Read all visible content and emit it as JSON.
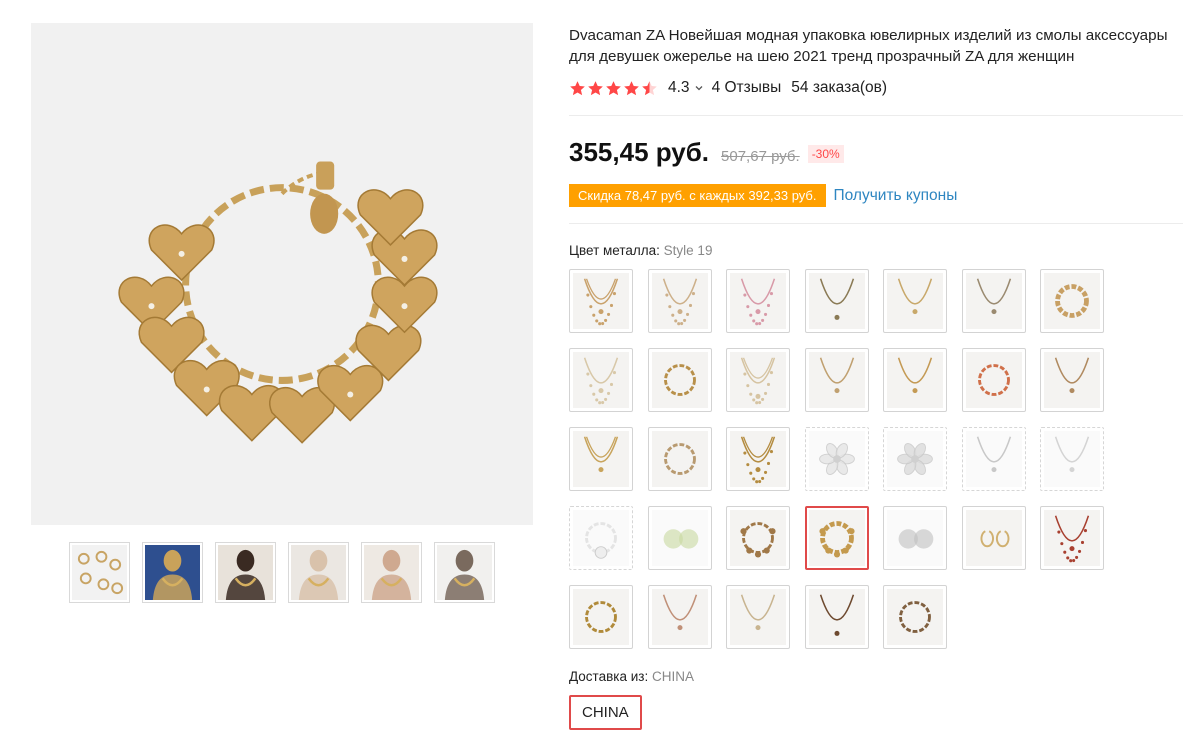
{
  "product": {
    "title": "Dvacaman ZA Новейшая модная упаковка ювелирных изделий из смолы аксессуары для девушек ожерелье на шею 2021 тренд прозрачный ZA для женщин",
    "rating": "4.3",
    "rating_stars": 4.5,
    "reviews": "4 Отзывы",
    "orders": "54 заказа(ов)"
  },
  "price": {
    "current": "355,45 руб.",
    "old": "507,67 руб.",
    "discount": "-30%"
  },
  "coupon": {
    "text": "Скидка 78,47 руб. с каждых 392,33 руб.",
    "link": "Получить купоны"
  },
  "sku": {
    "label": "Цвет металла:",
    "selected_value": "Style 19",
    "options": [
      {
        "kind": "necklace-layered",
        "color": "#c9a26c"
      },
      {
        "kind": "necklace-beads",
        "color": "#cdb08a"
      },
      {
        "kind": "necklace-pink",
        "color": "#d89aa8"
      },
      {
        "kind": "necklace-long",
        "color": "#8a7a55"
      },
      {
        "kind": "necklace-pendant",
        "color": "#c8a86a"
      },
      {
        "kind": "necklace-thin",
        "color": "#9a8a70"
      },
      {
        "kind": "bracelet-chunky",
        "color": "#c8a064"
      },
      {
        "kind": "necklace-pearl",
        "color": "#d8c8a8"
      },
      {
        "kind": "bracelet-gold",
        "color": "#b8904a"
      },
      {
        "kind": "necklace-pearl-long",
        "color": "#d6c4a2"
      },
      {
        "kind": "necklace-choker",
        "color": "#c0a070"
      },
      {
        "kind": "necklace-gold-drop",
        "color": "#c49a54"
      },
      {
        "kind": "bracelet-colorful",
        "color": "#d0704a"
      },
      {
        "kind": "necklace-charm",
        "color": "#b08a60"
      },
      {
        "kind": "necklace-chain-double",
        "color": "#c8a45c"
      },
      {
        "kind": "bracelet-beads",
        "color": "#b89a70"
      },
      {
        "kind": "necklace-chain-layered",
        "color": "#b48c40"
      },
      {
        "kind": "resin-flower",
        "color": "#e6e6e6"
      },
      {
        "kind": "resin-flower-2",
        "color": "#dcdcdc"
      },
      {
        "kind": "necklace-flower-white",
        "color": "#c8c8c8"
      },
      {
        "kind": "necklace-flower-clear",
        "color": "#d4d4d4"
      },
      {
        "kind": "bracelet-flower",
        "color": "#e4e4e4"
      },
      {
        "kind": "earrings-resin-green",
        "color": "#c8d8a0"
      },
      {
        "kind": "bracelet-charm",
        "color": "#a07848"
      },
      {
        "kind": "bracelet-hearts",
        "color": "#c49a4e"
      },
      {
        "kind": "earrings-resin-clear",
        "color": "#c0c0c0"
      },
      {
        "kind": "earrings-hoop",
        "color": "#d0b070"
      },
      {
        "kind": "necklace-red-beads",
        "color": "#a84030"
      },
      {
        "kind": "bracelet-twist",
        "color": "#b08a3a"
      },
      {
        "kind": "necklace-rope",
        "color": "#c09078"
      },
      {
        "kind": "necklace-fine",
        "color": "#c8b490"
      },
      {
        "kind": "necklace-lariat",
        "color": "#6e4a30"
      },
      {
        "kind": "bracelet-stones",
        "color": "#806040"
      }
    ],
    "selected_index": 24,
    "dashed_indices": [
      17,
      18,
      19,
      20,
      21
    ]
  },
  "shipping": {
    "label": "Доставка из:",
    "value": "CHINA",
    "option": "CHINA"
  },
  "gallery": {
    "main_kind": "bracelet-hearts",
    "thumbs": [
      "collage",
      "model-blue",
      "model-dark",
      "model-hat",
      "model-chain",
      "model-white"
    ]
  },
  "colors": {
    "star": "#ff4747",
    "link": "#2e86c1",
    "coupon_bg": "#ffa000",
    "selected_border": "#e04a4a"
  }
}
